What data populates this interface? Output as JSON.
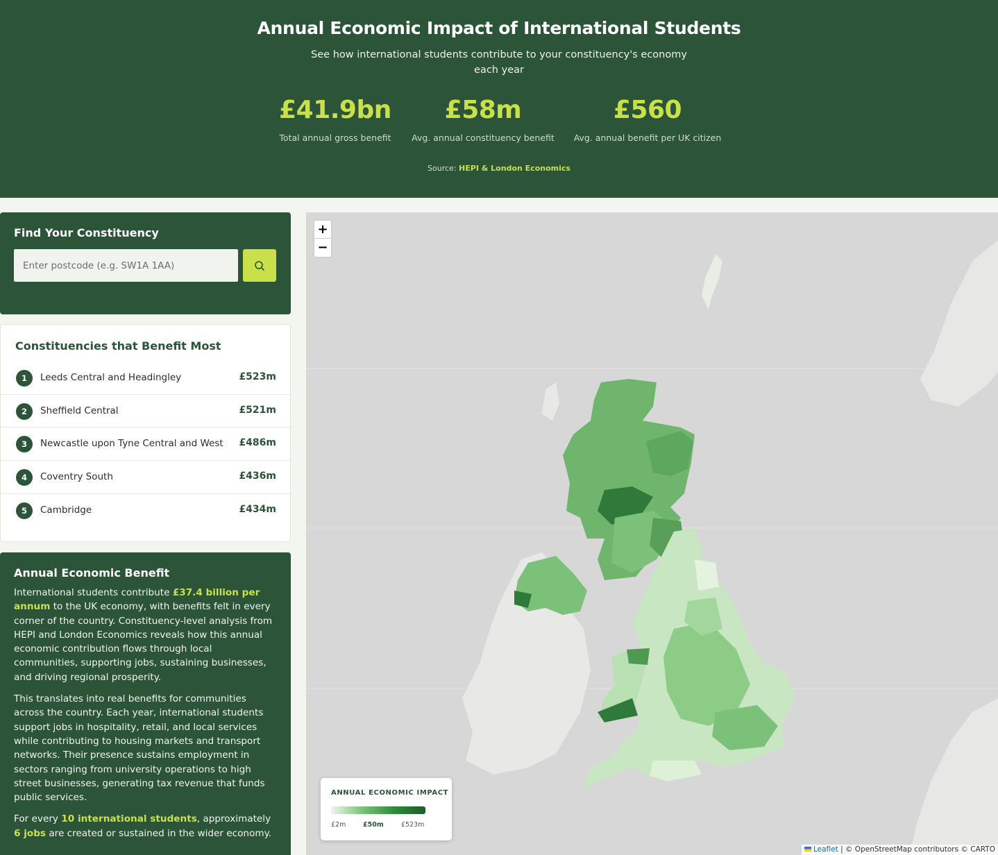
{
  "header": {
    "title": "Annual Economic Impact of International Students",
    "subtitle": "See how international students contribute to your constituency's economy each year",
    "source_label": "Source:",
    "source_name": "HEPI & London Economics"
  },
  "stats": [
    {
      "value": "£41.9bn",
      "label": "Total annual gross benefit"
    },
    {
      "value": "£58m",
      "label": "Avg. annual constituency benefit"
    },
    {
      "value": "£560",
      "label": "Avg. annual benefit per UK citizen"
    }
  ],
  "search": {
    "title": "Find Your Constituency",
    "placeholder": "Enter postcode (e.g. SW1A 1AA)",
    "button_icon": "search-icon"
  },
  "top_list": {
    "title": "Constituencies that Benefit Most",
    "items": [
      {
        "rank": "1",
        "name": "Leeds Central and Headingley",
        "value": "£523m"
      },
      {
        "rank": "2",
        "name": "Sheffield Central",
        "value": "£521m"
      },
      {
        "rank": "3",
        "name": "Newcastle upon Tyne Central and West",
        "value": "£486m"
      },
      {
        "rank": "4",
        "name": "Coventry South",
        "value": "£436m"
      },
      {
        "rank": "5",
        "name": "Cambridge",
        "value": "£434m"
      }
    ]
  },
  "benefit": {
    "title": "Annual Economic Benefit",
    "p1_a": "International students contribute ",
    "p1_hl": "£37.4 billion per annum",
    "p1_b": " to the UK economy, with benefits felt in every corner of the country. Constituency-level analysis from HEPI and London Economics reveals how this annual economic contribution flows through local communities, supporting jobs, sustaining businesses, and driving regional prosperity.",
    "p2": "This translates into real benefits for communities across the country. Each year, international students support jobs in hospitality, retail, and local services while contributing to housing markets and transport networks. Their presence sustains employment in sectors ranging from university operations to high street businesses, generating tax revenue that funds public services.",
    "p3_a": "For every ",
    "p3_hl1": "10 international students",
    "p3_b": ", approximately ",
    "p3_hl2": "6 jobs",
    "p3_c": " are created or sustained in the wider economy."
  },
  "map": {
    "zoom_in": "+",
    "zoom_out": "−",
    "legend_title": "ANNUAL ECONOMIC IMPACT",
    "legend_min": "£2m",
    "legend_mid": "£50m",
    "legend_max": "£523m",
    "attribution_link": "Leaflet",
    "attribution_text": " | © OpenStreetMap contributors © CARTO",
    "colors": {
      "low": "#eef7ea",
      "mid": "#7cc17a",
      "high": "#1c5c2a",
      "land": "#e9e9e8",
      "sea": "#d6d7d6"
    }
  },
  "colors": {
    "brand_dark": "#2b5439",
    "accent": "#c9e04a"
  }
}
